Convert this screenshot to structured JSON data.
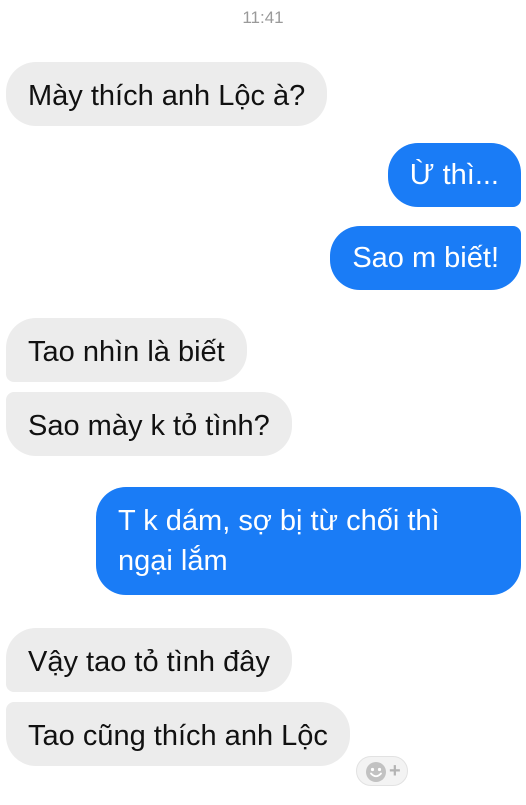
{
  "chat": {
    "timestamp": "11:41",
    "messages": [
      {
        "from": "them",
        "text": "Mày thích anh Lộc à?"
      },
      {
        "from": "me",
        "text": "Ừ thì..."
      },
      {
        "from": "me",
        "text": "Sao m biết!"
      },
      {
        "from": "them",
        "text": "Tao nhìn là biết"
      },
      {
        "from": "them",
        "text": "Sao mày k tỏ tình?"
      },
      {
        "from": "me",
        "text": "T k dám, sợ bị từ chối thì ngại lắm"
      },
      {
        "from": "them",
        "text": "Vậy tao tỏ tình đây"
      },
      {
        "from": "them",
        "text": "Tao cũng thích anh Lộc"
      }
    ],
    "reaction_icon": "smiley-plus-icon"
  },
  "colors": {
    "sent_bubble": "#1a7cf6",
    "received_bubble": "#ececec",
    "timestamp_text": "#9a9a9a"
  }
}
